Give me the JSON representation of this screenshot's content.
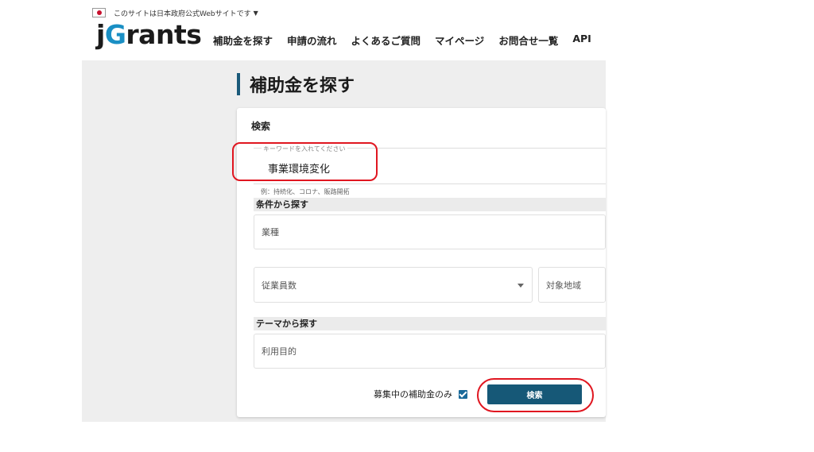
{
  "header": {
    "gov_notice": "このサイトは日本政府公式Webサイトです",
    "gov_notice_caret": "▼",
    "logo": {
      "j": "j",
      "g": "G",
      "rest": "rants"
    },
    "nav": [
      "補助金を探す",
      "申請の流れ",
      "よくあるご質問",
      "マイページ",
      "お問合せ一覧",
      "API"
    ]
  },
  "page": {
    "title": "補助金を探す"
  },
  "search": {
    "title": "検索",
    "keyword_placeholder": "キーワードを入れてください",
    "keyword_value": "事業環境変化",
    "keyword_hint": "例：持続化、コロナ、販路開拓",
    "conditions_heading": "条件から探す",
    "industry_label": "業種",
    "employees_label": "従業員数",
    "region_label": "対象地域",
    "theme_heading": "テーマから探す",
    "purpose_label": "利用目的",
    "recruiting_only_label": "募集中の補助金のみ",
    "recruiting_only_checked": true,
    "submit_label": "検索"
  },
  "colors": {
    "accent": "#165877",
    "logo_g": "#1a8fc4",
    "highlight": "#e01620"
  }
}
